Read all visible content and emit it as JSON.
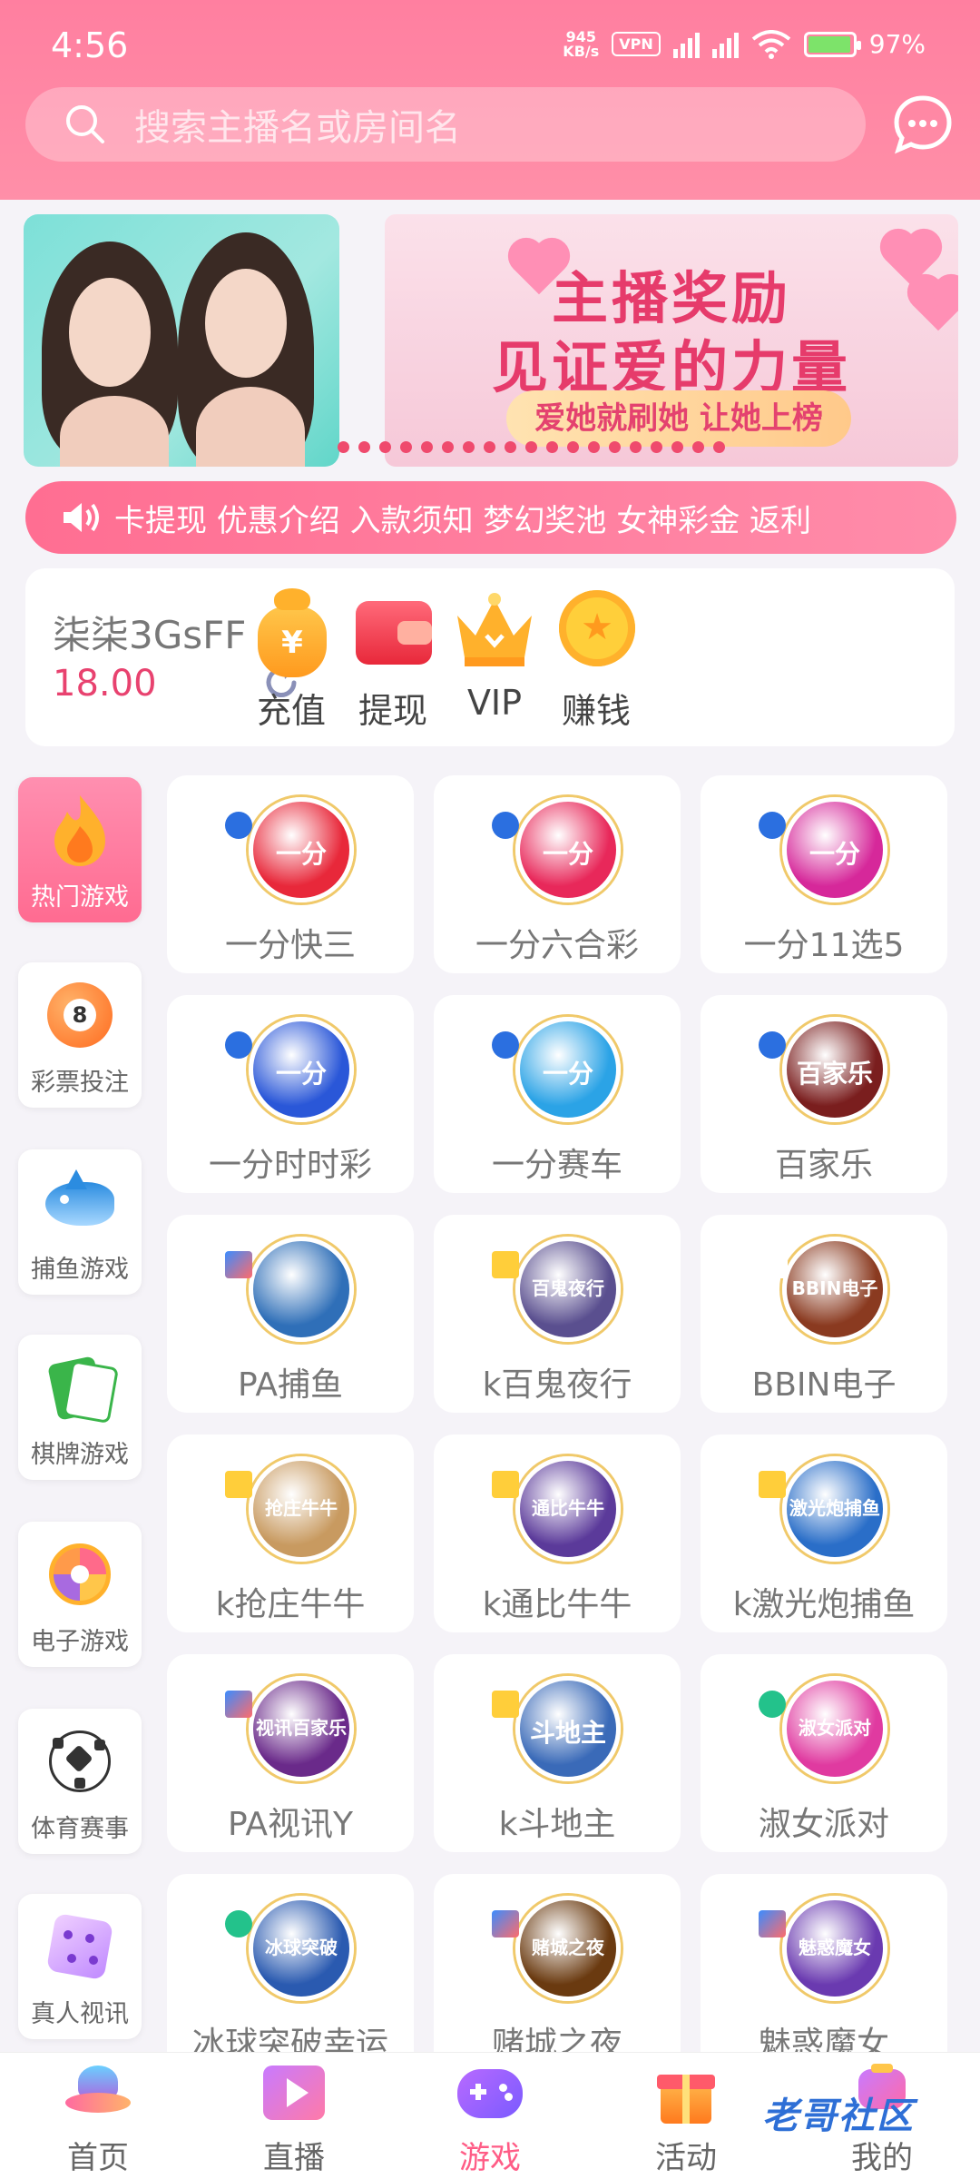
{
  "status_bar": {
    "time": "4:56",
    "net_speed_value": "945",
    "net_speed_unit": "KB/s",
    "vpn": "VPN",
    "battery": "97%",
    "battery_level": 0.97
  },
  "search": {
    "placeholder": "搜索主播名或房间名"
  },
  "banner": {
    "title_line1": "主播奖励",
    "title_line2": "见证爱的力量",
    "subtitle": "爱她就刷她 让她上榜"
  },
  "marquee": {
    "text": "卡提现 优惠介绍 入款须知 梦幻奖池 女神彩金 返利"
  },
  "wallet": {
    "username": "柒柒3GsFF",
    "balance": "18.00",
    "actions": [
      {
        "label": "充值",
        "icon": "money-bag-icon"
      },
      {
        "label": "提现",
        "icon": "wallet-icon"
      },
      {
        "label": "VIP",
        "icon": "crown-icon"
      },
      {
        "label": "赚钱",
        "icon": "coin-icon"
      }
    ]
  },
  "sidebar": [
    {
      "label": "热门游戏",
      "icon": "flame-icon",
      "active": true
    },
    {
      "label": "彩票投注",
      "icon": "lottery-ball-icon"
    },
    {
      "label": "捕鱼游戏",
      "icon": "shark-icon"
    },
    {
      "label": "棋牌游戏",
      "icon": "mahjong-icon"
    },
    {
      "label": "电子游戏",
      "icon": "wheel-icon"
    },
    {
      "label": "体育赛事",
      "icon": "soccer-ball-icon"
    },
    {
      "label": "真人视讯",
      "icon": "dice-icon"
    }
  ],
  "games": [
    {
      "name": "一分快三",
      "logo_text": "一分",
      "color": "#e8283a",
      "badge": "ib"
    },
    {
      "name": "一分六合彩",
      "logo_text": "一分",
      "color": "#e8285a",
      "badge": "ib"
    },
    {
      "name": "一分11选5",
      "logo_text": "一分",
      "color": "#d6289a",
      "badge": "ib"
    },
    {
      "name": "一分时时彩",
      "logo_text": "一分",
      "color": "#2a57d8",
      "badge": "ib"
    },
    {
      "name": "一分赛车",
      "logo_text": "一分",
      "color": "#2ba3e6",
      "badge": "ib"
    },
    {
      "name": "百家乐",
      "logo_text": "百家乐",
      "color": "#7a1e1e",
      "badge": "ib"
    },
    {
      "name": "PA捕鱼",
      "logo_text": "",
      "color": "#2f6fb8",
      "badge": "M"
    },
    {
      "name": "k百鬼夜行",
      "logo_text": "百鬼夜行",
      "color": "#5a4f8f",
      "badge": "KY"
    },
    {
      "name": "BBIN电子",
      "logo_text": "BBIN电子",
      "color": "#8a3a20",
      "badge": "bbn"
    },
    {
      "name": "k抢庄牛牛",
      "logo_text": "抢庄牛牛",
      "color": "#c89a60",
      "badge": "KY"
    },
    {
      "name": "k通比牛牛",
      "logo_text": "通比牛牛",
      "color": "#5b3a9a",
      "badge": "KY"
    },
    {
      "name": "k激光炮捕鱼",
      "logo_text": "激光炮捕鱼",
      "color": "#2a6ec8",
      "badge": "KY"
    },
    {
      "name": "PA视讯Y",
      "logo_text": "视讯百家乐",
      "color": "#6a2a8a",
      "badge": "M"
    },
    {
      "name": "k斗地主",
      "logo_text": "斗地主",
      "color": "#3a6ab8",
      "badge": "KY"
    },
    {
      "name": "淑女派对",
      "logo_text": "淑女派对",
      "color": "#e03aa0",
      "badge": "G"
    },
    {
      "name": "冰球突破幸运",
      "logo_text": "冰球突破",
      "color": "#2a5ab0",
      "badge": "G"
    },
    {
      "name": "赌城之夜",
      "logo_text": "赌城之夜",
      "color": "#6a3a10",
      "badge": "M"
    },
    {
      "name": "魅惑魔女",
      "logo_text": "魅惑魔女",
      "color": "#6a3ab0",
      "badge": "M"
    }
  ],
  "bottom_nav": [
    {
      "label": "首页",
      "icon": "home-ufo-icon"
    },
    {
      "label": "直播",
      "icon": "live-play-icon"
    },
    {
      "label": "游戏",
      "icon": "gamepad-icon",
      "active": true
    },
    {
      "label": "活动",
      "icon": "gift-icon"
    },
    {
      "label": "我的",
      "icon": "profile-icon"
    }
  ],
  "watermark": "老哥社区",
  "colors": {
    "primary": "#ff6b91",
    "accent": "#e8426f"
  }
}
